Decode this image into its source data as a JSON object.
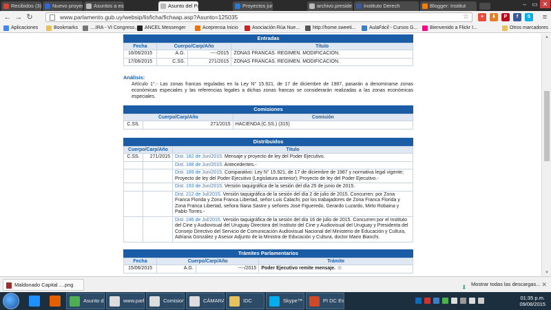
{
  "browser": {
    "tabs": [
      {
        "title": "Recibidos (3) - d",
        "icon": "gmail-icon",
        "color": "#d44638"
      },
      {
        "title": "Nuevo proyecto",
        "icon": "document-icon",
        "color": "#3367d6"
      },
      {
        "title": "Asuntos a estudi",
        "icon": "document-icon",
        "color": "#bbbbbb"
      },
      {
        "title": "Asunto del Parla",
        "icon": "document-icon",
        "color": "#bbbbbb"
      },
      {
        "title": "Proyectos junio",
        "icon": "document-icon",
        "color": "#2a7ad5"
      },
      {
        "title": "archivo.preside",
        "icon": "document-icon",
        "color": "#bbbbbb"
      },
      {
        "title": "Instituto Derech",
        "icon": "facebook-icon",
        "color": "#3b5998"
      },
      {
        "title": "Blogger: Institut",
        "icon": "blogger-icon",
        "color": "#f57d00"
      }
    ],
    "active_tab_index": 3,
    "url": "www.parlamento.gub.uy/websip/lisficha/fichaap.asp?Asunto=125035",
    "extensions": [
      "+",
      "⬇",
      "P",
      "f",
      "S"
    ],
    "bookmarks": [
      {
        "label": "Aplicaciones",
        "icon": "apps-icon",
        "color": "#4285f4"
      },
      {
        "label": "Bookmarks",
        "icon": "folder-icon",
        "color": "#e8c15a"
      },
      {
        "label": "....IRA - VI Congreso...",
        "icon": "page-icon",
        "color": "#777777"
      },
      {
        "label": "ANCEL Messenger",
        "icon": "ancel-icon",
        "color": "#222222"
      },
      {
        "label": "Aceprensa Inicio",
        "icon": "aceprensa-icon",
        "color": "#e8740c"
      },
      {
        "label": "Asociación Rúa Nue...",
        "icon": "page-icon",
        "color": "#cc2222"
      },
      {
        "label": "http://home.sweeti...",
        "icon": "page-icon",
        "color": "#555555"
      },
      {
        "label": "AulaFácil - Cursos G...",
        "icon": "page-icon",
        "color": "#3a7fc8"
      },
      {
        "label": "Bienvenido a Flickr I...",
        "icon": "flickr-icon",
        "color": "#ff0084"
      },
      {
        "label": "Otros marcadores",
        "icon": "folder-icon",
        "color": "#e8c15a"
      }
    ]
  },
  "entradas": {
    "title": "Entradas",
    "headers": [
      "Fecha",
      "Cuerpo/Carp/Año",
      "Título"
    ],
    "rows": [
      [
        "16/06/2015",
        "A.G.",
        "----/2015",
        "ZONAS FRANCAS. REGIMEN. MODIFICACION."
      ],
      [
        "17/06/2015",
        "C.SS.",
        "271/2015",
        "ZONAS FRANCAS. REGIMEN. MODIFICACION."
      ]
    ]
  },
  "analisis": {
    "label": "Análisis:",
    "text": "Artículo 1°.- Las zonas francas reguladas en la Ley N° 15.921, de 17 de diciembre de 1987, pasarán a denominarse zonas económicas especiales y las referencias legales a dichas zonas francas se considerarán realizadas a las zonas económicas especiales."
  },
  "comisiones": {
    "title": "Comisiones",
    "headers": [
      "Cuerpo/Carp/Año",
      "Comisión"
    ],
    "rows": [
      [
        "C.SS.",
        "271/2015",
        "HACIENDA (C.SS.) (315)"
      ]
    ]
  },
  "distribuidos": {
    "title": "Distribuidos",
    "headers": [
      "Cuerpo/Carp/Año",
      "Título"
    ],
    "rows": [
      {
        "cuerpo": "C.SS.",
        "carp": "271/2015",
        "link": "Dist. 182 de Jun/2015.",
        "text": "Mensaje y proyecto de ley del Poder Ejecutivo."
      },
      {
        "cuerpo": "",
        "carp": "",
        "link": "Dist. 188 de Jun/2015.",
        "text": "Antecedentes.-"
      },
      {
        "cuerpo": "",
        "carp": "",
        "link": "Dist. 189 de Jun/2015.",
        "text": "Comparativo: Ley N° 15.921, de 17 de diciembre de 1987 y normativa legal vigente; Proyecto de ley del Poder Ejecutivo (Legislatura anterior); Proyecto de ley del Poder Ejecutivo.-"
      },
      {
        "cuerpo": "",
        "carp": "",
        "link": "Dist. 193 de Jun/2015.",
        "text": "Versión taquigráfica de la sesión del día 25 de junio de 2015."
      },
      {
        "cuerpo": "",
        "carp": "",
        "link": "Dist. 212 de Jul/2015.",
        "text": "Versión taquigráfica de la sesión del día 2 de julio de 2015. Concurren: por Zona Franca Florida y Zona Franca Libertad, señor Luis Calachi; por los trabajadores de Zona Franca Florida y Zona Franca Libertad, señora Iliana Sastre y señores José Figueredo, Gerardo Luzardo, Mirto Robaina y Pablo Torres.-"
      },
      {
        "cuerpo": "",
        "carp": "",
        "link": "Dist. 246 de Jul/2015.",
        "text": "Versión taquigráfica de la sesión del día 16 de julio de 2015. Concurren por el Instituto del Cine y Audiovisual del Uruguay Directora del Instituto del Cine y Audiovisual del Uruguay y Presidenta del Consejo Directivo del Servicio de Comunicación Audiovisual Nacional del Ministerio de Educación y Cultura, Adriana González y Asesor Adjunto de la Ministra de Educación y Cultura, doctor Mario Bianchi."
      }
    ]
  },
  "tramites": {
    "title": "Trámites Parlamentarios",
    "headers": [
      "Fecha",
      "Cuerpo/Carp/Año",
      "Trámite"
    ],
    "rows": [
      [
        "15/06/2015",
        "A.G.",
        "----/2015",
        "Poder Ejecutivo remite mensaje."
      ]
    ]
  },
  "downloads": {
    "file": "Maldonado Capital ....png",
    "show_all": "Mostrar todas las descargas..."
  },
  "taskbar": {
    "items": [
      {
        "label": "",
        "icon": "ie-icon",
        "color": "#1e90ff"
      },
      {
        "label": "",
        "icon": "firefox-icon",
        "color": "#e66000"
      },
      {
        "label": "Asunto de...",
        "icon": "chrome-icon",
        "color": "#4caf50"
      },
      {
        "label": "www.parla...",
        "icon": "document-icon",
        "color": "#dddddd"
      },
      {
        "label": "Comision...",
        "icon": "document-icon",
        "color": "#dddddd"
      },
      {
        "label": "CÁMARA ...",
        "icon": "document-icon",
        "color": "#dddddd"
      },
      {
        "label": "IDC",
        "icon": "folder-icon",
        "color": "#e8c15a"
      },
      {
        "label": "Skype™ - ...",
        "icon": "skype-icon",
        "color": "#00aff0"
      },
      {
        "label": "PI DC Esq...",
        "icon": "powerpoint-icon",
        "color": "#d24726"
      }
    ],
    "time": "01:35 p.m.",
    "date": "09/08/2015"
  }
}
